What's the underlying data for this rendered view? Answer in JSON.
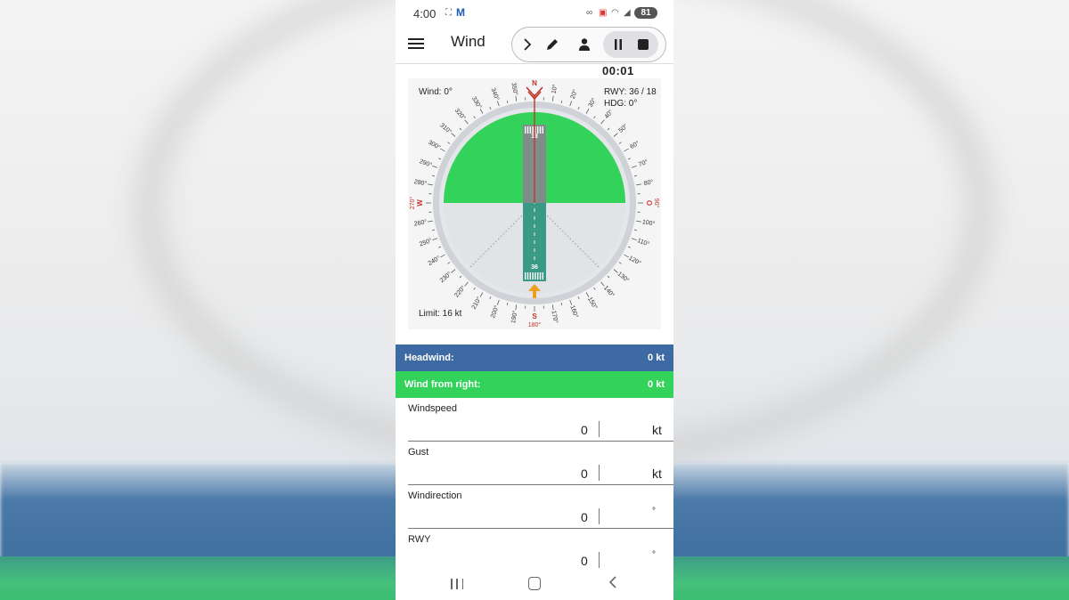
{
  "status_bar": {
    "time": "4:00",
    "battery": "81"
  },
  "app_bar": {
    "title": "Wind",
    "timer": "00:01"
  },
  "compass": {
    "wind_text": "Wind: 0°",
    "runway_text": "RWY:  36 / 18",
    "heading_text": "HDG:  0°",
    "limit_text": "Limit: 16 kt",
    "runway_top_number": "18",
    "runway_bottom_number": "36",
    "wind_direction_deg": 0,
    "runway_heading_deg": 360,
    "crosswind_limit_kt": 16,
    "cardinal_labels": {
      "N": "N",
      "E": "O",
      "S": "S",
      "W": "W"
    },
    "cardinal_degree_labels": {
      "east": "90°",
      "south": "180°",
      "west": "270°"
    },
    "degree_labels": [
      "10°",
      "20°",
      "30°",
      "40°",
      "50°",
      "60°",
      "70°",
      "80°",
      "100°",
      "110°",
      "120°",
      "130°",
      "140°",
      "150°",
      "160°",
      "170°",
      "190°",
      "200°",
      "210°",
      "220°",
      "230°",
      "240°",
      "250°",
      "260°",
      "280°",
      "290°",
      "300°",
      "310°",
      "320°",
      "330°",
      "340°",
      "350°"
    ],
    "colors": {
      "headwind_zone": "#33d25a",
      "tailwind_zone": "#e1e3e6",
      "runway": "#7f8c8a",
      "runway_green": "#3a9a86",
      "wind_marker": "#c0392b",
      "heading_arrow": "#f0a020",
      "cardinal_red": "#c0392b"
    }
  },
  "results": {
    "headwind_label": "Headwind:",
    "headwind_value": "0 kt",
    "crosswind_label": "Wind from right:",
    "crosswind_value": "0 kt",
    "headwind_color": "#3e6aa3",
    "crosswind_color": "#33d25a"
  },
  "fields": [
    {
      "label": "Windspeed",
      "value": "0",
      "unit": "kt"
    },
    {
      "label": "Gust",
      "value": "0",
      "unit": "kt"
    },
    {
      "label": "Windirection",
      "value": "0",
      "unit": "°"
    },
    {
      "label": "RWY",
      "value": "0",
      "unit": "°"
    }
  ],
  "icons": {
    "menu": "menu-icon",
    "next": "chevron-right-icon",
    "edit": "pencil-icon",
    "profile": "person-icon",
    "pause": "pause-icon",
    "stop": "stop-icon"
  }
}
